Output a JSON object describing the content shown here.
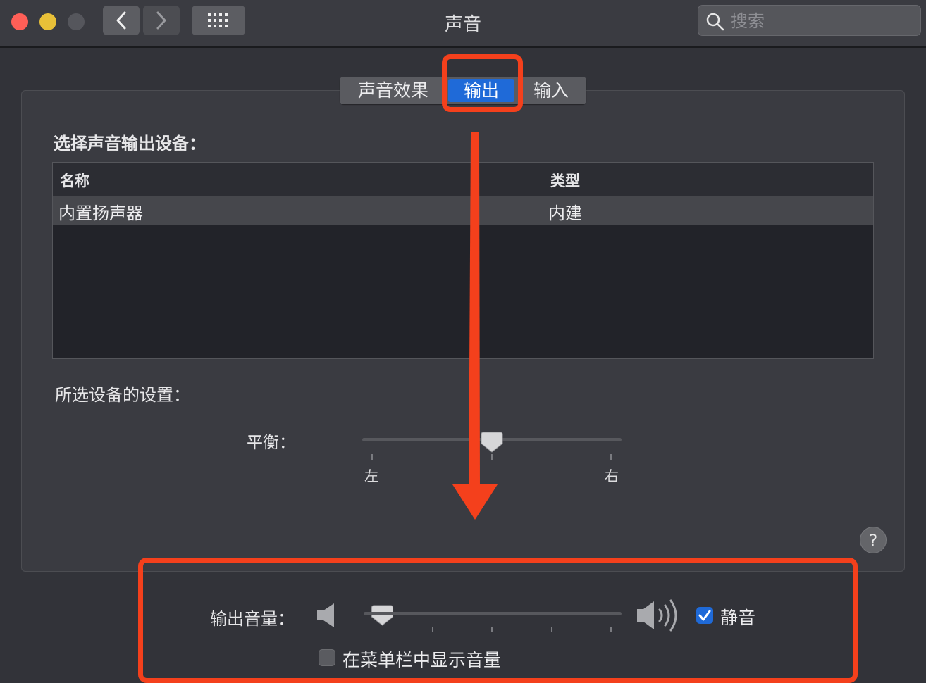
{
  "window": {
    "title": "声音"
  },
  "search": {
    "placeholder": "搜索"
  },
  "tabs": [
    {
      "label": "声音效果",
      "selected": false
    },
    {
      "label": "输出",
      "selected": true
    },
    {
      "label": "输入",
      "selected": false
    }
  ],
  "output": {
    "select_label": "选择声音输出设备：",
    "columns": {
      "name": "名称",
      "type": "类型"
    },
    "devices": [
      {
        "name": "内置扬声器",
        "type": "内建",
        "selected": true
      }
    ]
  },
  "device_settings": {
    "label": "所选设备的设置：",
    "balance_label": "平衡：",
    "balance_left": "左",
    "balance_right": "右",
    "balance_value_fraction": 0.5
  },
  "volume": {
    "label": "输出音量：",
    "value_fraction": 0.04,
    "mute_label": "静音",
    "mute_checked": true,
    "show_in_menubar_label": "在菜单栏中显示音量",
    "show_in_menubar_checked": false
  },
  "help": {
    "symbol": "?"
  },
  "annotation": {
    "color": "#f4401c"
  }
}
